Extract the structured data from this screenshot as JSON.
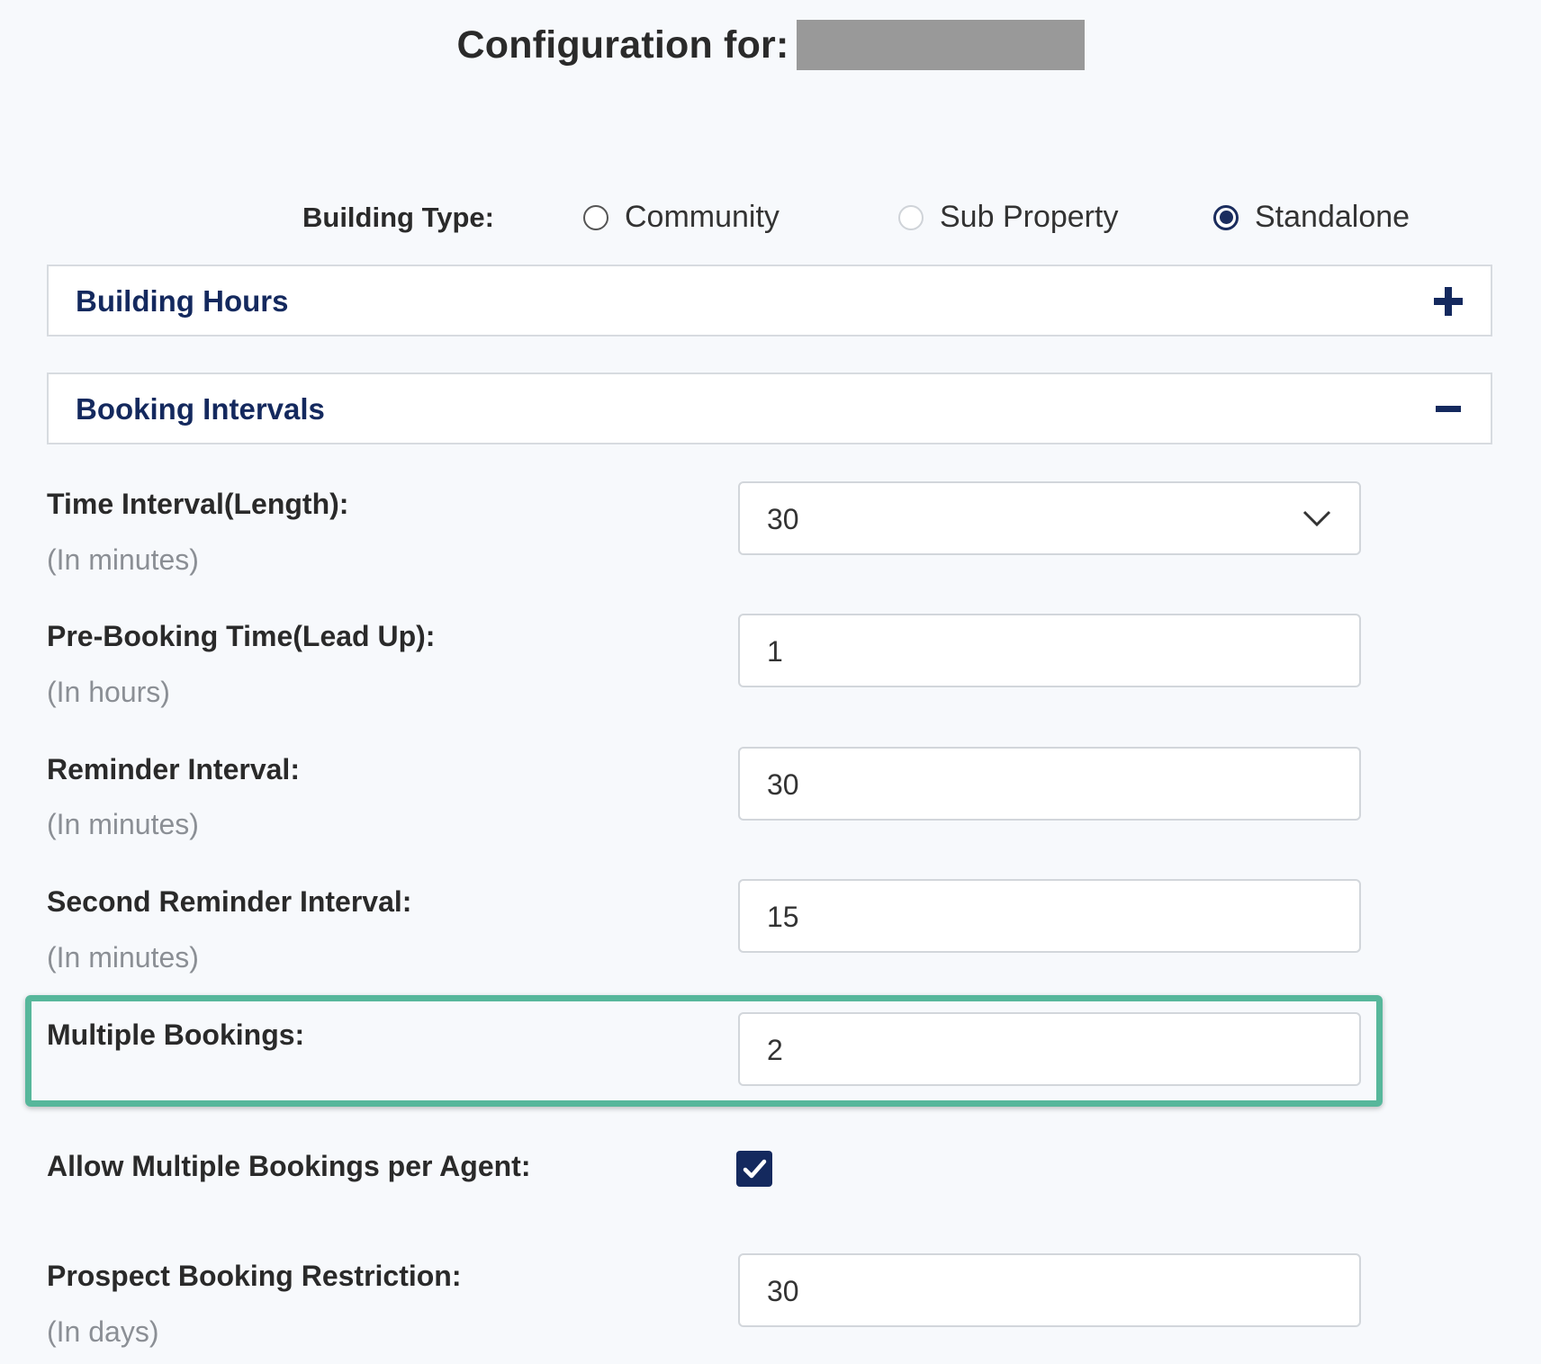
{
  "header": {
    "title": "Configuration for:"
  },
  "building_type": {
    "label": "Building Type:",
    "options": [
      {
        "label": "Community",
        "state": "unchecked"
      },
      {
        "label": "Sub Property",
        "state": "disabled"
      },
      {
        "label": "Standalone",
        "state": "checked"
      }
    ]
  },
  "sections": {
    "building_hours": {
      "title": "Building Hours",
      "icon": "plus-icon"
    },
    "booking_intervals": {
      "title": "Booking Intervals",
      "icon": "minus-icon"
    }
  },
  "fields": {
    "time_interval": {
      "label": "Time Interval(Length):",
      "hint": "(In minutes)",
      "value": "30"
    },
    "pre_booking": {
      "label": "Pre-Booking Time(Lead Up):",
      "hint": "(In hours)",
      "value": "1"
    },
    "reminder": {
      "label": "Reminder Interval:",
      "hint": "(In minutes)",
      "value": "30"
    },
    "second_reminder": {
      "label": "Second Reminder Interval:",
      "hint": "(In minutes)",
      "value": "15"
    },
    "multiple_bookings": {
      "label": "Multiple Bookings:",
      "value": "2"
    },
    "allow_multiple": {
      "label": "Allow Multiple Bookings per Agent:",
      "checked": true
    },
    "prospect_restriction": {
      "label": "Prospect Booking Restriction:",
      "hint": "(In days)",
      "value": "30"
    }
  },
  "colors": {
    "accent_navy": "#14295e",
    "highlight_green": "#57b79b",
    "background": "#f7f9fc",
    "redaction_gray": "#999999"
  }
}
